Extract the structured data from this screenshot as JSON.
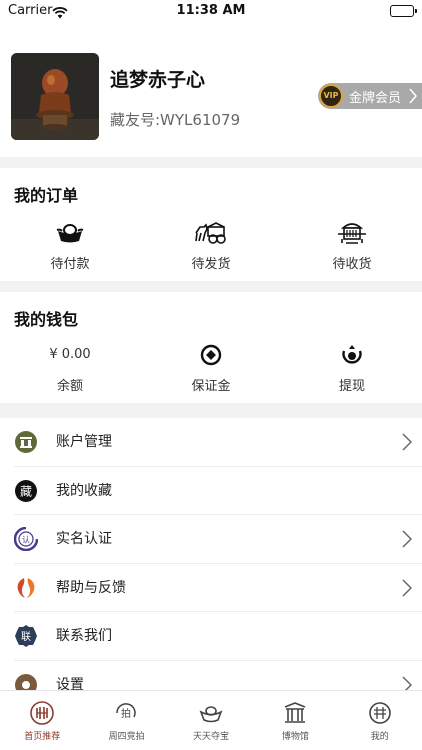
{
  "status_bar": {
    "carrier": "Carrier",
    "time": "11:38 AM"
  },
  "profile": {
    "username": "追梦赤子心",
    "collector_id": "藏友号:WYL61079",
    "vip_icon_text": "VIP",
    "vip_label": "金牌会员"
  },
  "orders": {
    "title": "我的订单",
    "items": [
      {
        "label": "待付款",
        "icon": "gold-ingot-icon"
      },
      {
        "label": "待发货",
        "icon": "horse-carriage-icon"
      },
      {
        "label": "待收货",
        "icon": "sedan-chair-icon"
      }
    ]
  },
  "wallet": {
    "title": "我的钱包",
    "balance_value": "¥ 0.00",
    "balance_label": "余额",
    "deposit_label": "保证金",
    "withdraw_label": "提现"
  },
  "menu": {
    "items": [
      {
        "label": "账户管理",
        "icon": "account-icon",
        "has_arrow": true
      },
      {
        "label": "我的收藏",
        "icon": "collection-icon",
        "icon_text": "藏",
        "has_arrow": false
      },
      {
        "label": "实名认证",
        "icon": "verify-icon",
        "icon_text": "认",
        "has_arrow": true
      },
      {
        "label": "帮助与反馈",
        "icon": "help-icon",
        "has_arrow": true
      },
      {
        "label": "联系我们",
        "icon": "contact-icon",
        "icon_text": "联",
        "has_arrow": false
      },
      {
        "label": "设置",
        "icon": "settings-icon",
        "has_arrow": true
      }
    ]
  },
  "tabbar": {
    "tabs": [
      {
        "label": "首页推荐",
        "icon": "home-icon",
        "active": true
      },
      {
        "label": "周四竞拍",
        "icon": "auction-icon",
        "icon_text": "拍",
        "active": false
      },
      {
        "label": "天天夺宝",
        "icon": "treasure-icon",
        "active": false
      },
      {
        "label": "博物馆",
        "icon": "museum-icon",
        "active": false
      },
      {
        "label": "我的",
        "icon": "mine-icon",
        "active": false
      }
    ]
  },
  "colors": {
    "accent": "#8a3a2e",
    "vip_gold": "#d8a63c",
    "vip_bg": "#a9a9a9"
  }
}
